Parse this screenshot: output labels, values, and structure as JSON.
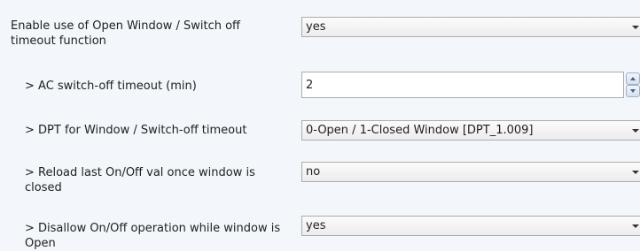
{
  "rows": [
    {
      "label": "Enable use of Open Window / Switch off timeout function",
      "value": "yes"
    },
    {
      "label": "> AC switch-off timeout (min)",
      "value": "2"
    },
    {
      "label": "> DPT for Window / Switch-off timeout",
      "value": "0-Open / 1-Closed Window [DPT_1.009]"
    },
    {
      "label": "> Reload last On/Off val once window is closed",
      "value": "no"
    },
    {
      "label": "> Disallow On/Off operation while window is Open",
      "value": "yes"
    }
  ],
  "icons": {
    "dropdown": "chevron-down-icon",
    "spin_up": "spin-up-icon",
    "spin_down": "spin-down-icon"
  }
}
